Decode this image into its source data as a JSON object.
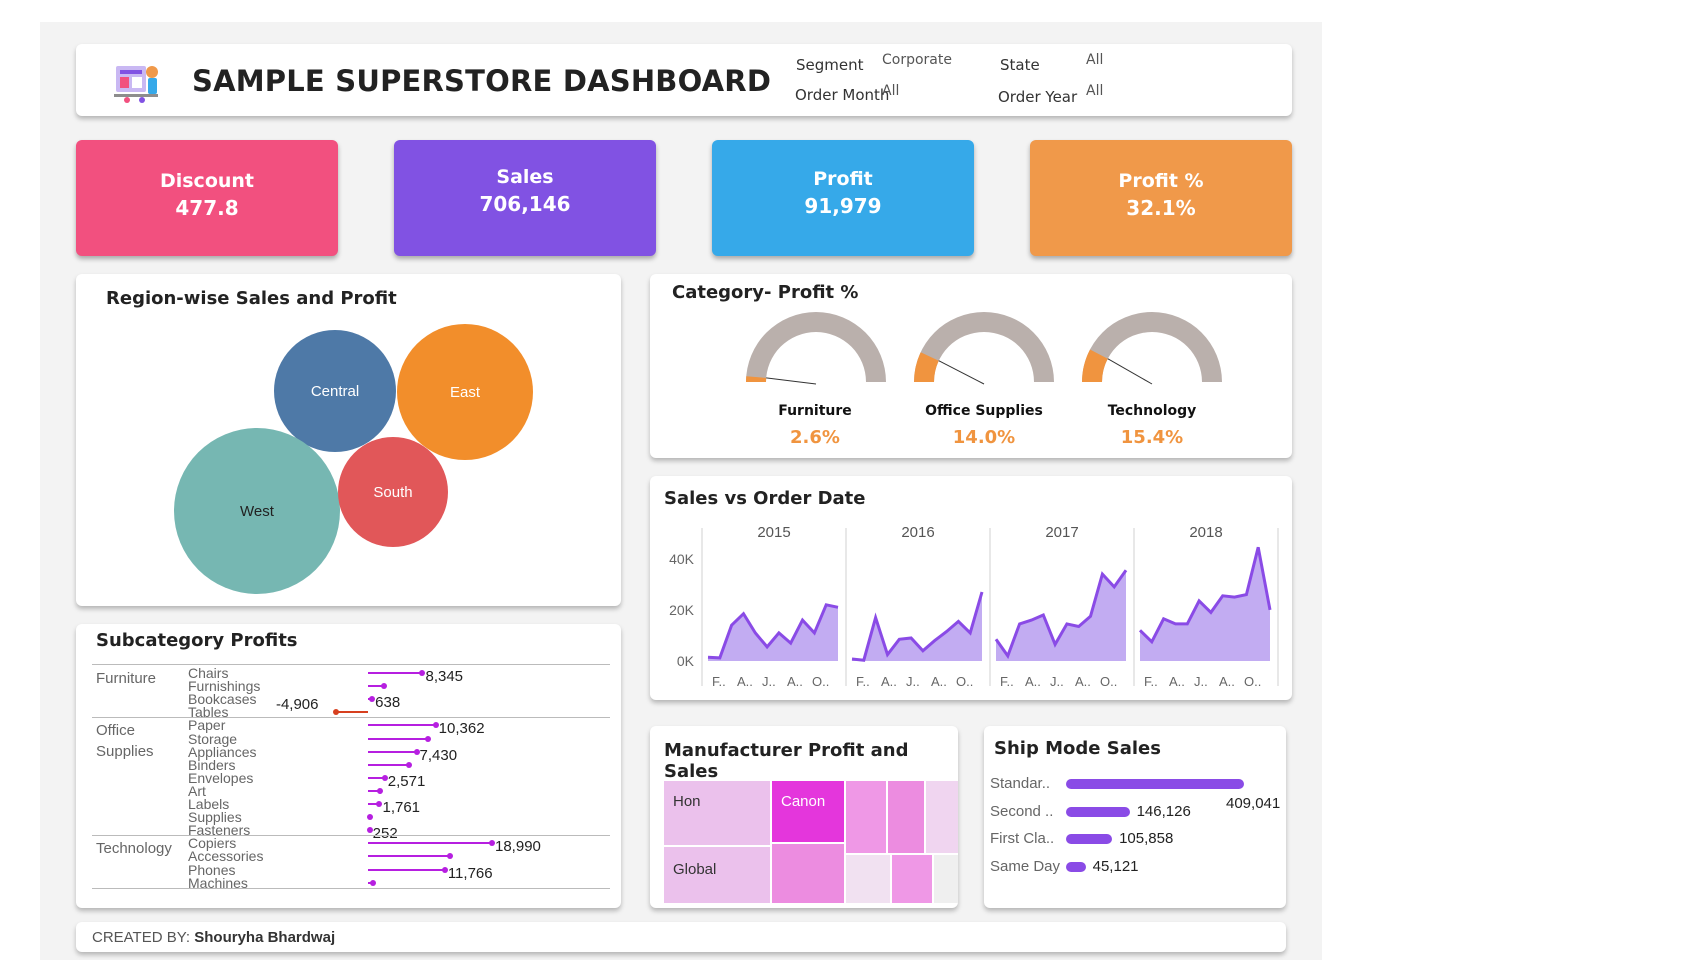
{
  "header": {
    "title": "SAMPLE SUPERSTORE DASHBOARD",
    "filters": {
      "segment_label": "Segment",
      "segment_value": "Corporate",
      "state_label": "State",
      "state_value": "All",
      "order_month_label": "Order Month",
      "order_month_value": "All",
      "order_year_label": "Order Year",
      "order_year_value": "All"
    }
  },
  "kpis": [
    {
      "label": "Discount",
      "value": "477.8",
      "color": "#f2507f"
    },
    {
      "label": "Sales",
      "value": "706,146",
      "color": "#8152e3"
    },
    {
      "label": "Profit",
      "value": "91,979",
      "color": "#36a9e9"
    },
    {
      "label": "Profit %",
      "value": "32.1%",
      "color": "#f0994a"
    }
  ],
  "region": {
    "title": "Region-wise Sales and Profit",
    "bubbles": [
      {
        "name": "Central",
        "color": "#4e79a7"
      },
      {
        "name": "East",
        "color": "#f28e2b"
      },
      {
        "name": "West",
        "color": "#76b7b2"
      },
      {
        "name": "South",
        "color": "#e15759"
      }
    ]
  },
  "category_profit": {
    "title": "Category- Profit %",
    "items": [
      {
        "name": "Furniture",
        "value": "2.6%",
        "fraction": 0.026
      },
      {
        "name": "Office Supplies",
        "value": "14.0%",
        "fraction": 0.14
      },
      {
        "name": "Technology",
        "value": "15.4%",
        "fraction": 0.154
      }
    ],
    "track_color": "#bab0ac",
    "fill_color": "#f0943f"
  },
  "subcategory": {
    "title": "Subcategory Profits",
    "groups": [
      {
        "category": "Furniture",
        "items": [
          {
            "name": "Chairs",
            "value": 8345,
            "label": "8,345"
          },
          {
            "name": "Furnishings",
            "value": 2400,
            "label": ""
          },
          {
            "name": "Bookcases",
            "value": 638,
            "label": "638"
          },
          {
            "name": "Tables",
            "value": -4906,
            "label": "-4,906"
          }
        ]
      },
      {
        "category": "Office Supplies",
        "items": [
          {
            "name": "Paper",
            "value": 10362,
            "label": "10,362"
          },
          {
            "name": "Storage",
            "value": 9200,
            "label": ""
          },
          {
            "name": "Appliances",
            "value": 7430,
            "label": "7,430"
          },
          {
            "name": "Binders",
            "value": 6300,
            "label": ""
          },
          {
            "name": "Envelopes",
            "value": 2571,
            "label": "2,571"
          },
          {
            "name": "Art",
            "value": 1900,
            "label": ""
          },
          {
            "name": "Labels",
            "value": 1761,
            "label": "1,761"
          },
          {
            "name": "Supplies",
            "value": 300,
            "label": ""
          },
          {
            "name": "Fasteners",
            "value": 252,
            "label": "252"
          }
        ]
      },
      {
        "category": "Technology",
        "items": [
          {
            "name": "Copiers",
            "value": 18990,
            "label": "18,990"
          },
          {
            "name": "Accessories",
            "value": 12500,
            "label": ""
          },
          {
            "name": "Phones",
            "value": 11766,
            "label": "11,766"
          },
          {
            "name": "Machines",
            "value": 700,
            "label": ""
          }
        ]
      }
    ],
    "pos_color": "#b61fe0",
    "neg_color": "#d7401f"
  },
  "chart_data": {
    "type": "area",
    "title": "Sales vs Order Date",
    "years": [
      "2015",
      "2016",
      "2017",
      "2018"
    ],
    "month_tick_labels": [
      "F..",
      "A..",
      "J..",
      "A..",
      "O.."
    ],
    "y_ticks": [
      "40K",
      "20K",
      "0K"
    ],
    "ylim": [
      0,
      45000
    ],
    "series": [
      {
        "year": "2015",
        "values": [
          1500,
          1200,
          14000,
          18500,
          11000,
          5500,
          11000,
          7000,
          16000,
          11000,
          22000,
          21000
        ]
      },
      {
        "year": "2016",
        "values": [
          800,
          300,
          17000,
          2500,
          8500,
          9000,
          4000,
          8000,
          11500,
          15500,
          11000,
          27000
        ]
      },
      {
        "year": "2017",
        "values": [
          8500,
          2000,
          14500,
          16000,
          18000,
          6500,
          14500,
          13500,
          17500,
          34000,
          29000,
          35500
        ]
      },
      {
        "year": "2018",
        "values": [
          12000,
          7500,
          16500,
          14500,
          14500,
          23500,
          19000,
          25500,
          25000,
          26000,
          44500,
          20000
        ]
      }
    ],
    "color": "#8a4be6"
  },
  "manufacturer": {
    "title": "Manufacturer Profit and Sales",
    "labels": [
      "Hon",
      "Canon",
      "Global"
    ]
  },
  "ship_mode": {
    "title": "Ship Mode Sales",
    "items": [
      {
        "name": "Standar..",
        "value": 409041,
        "label": "409,041"
      },
      {
        "name": "Second ..",
        "value": 146126,
        "label": "146,126"
      },
      {
        "name": "First Cla..",
        "value": 105858,
        "label": "105,858"
      },
      {
        "name": "Same Day",
        "value": 45121,
        "label": "45,121"
      }
    ]
  },
  "footer": {
    "prefix": "CREATED BY: ",
    "author": "Shouryha Bhardwaj"
  }
}
